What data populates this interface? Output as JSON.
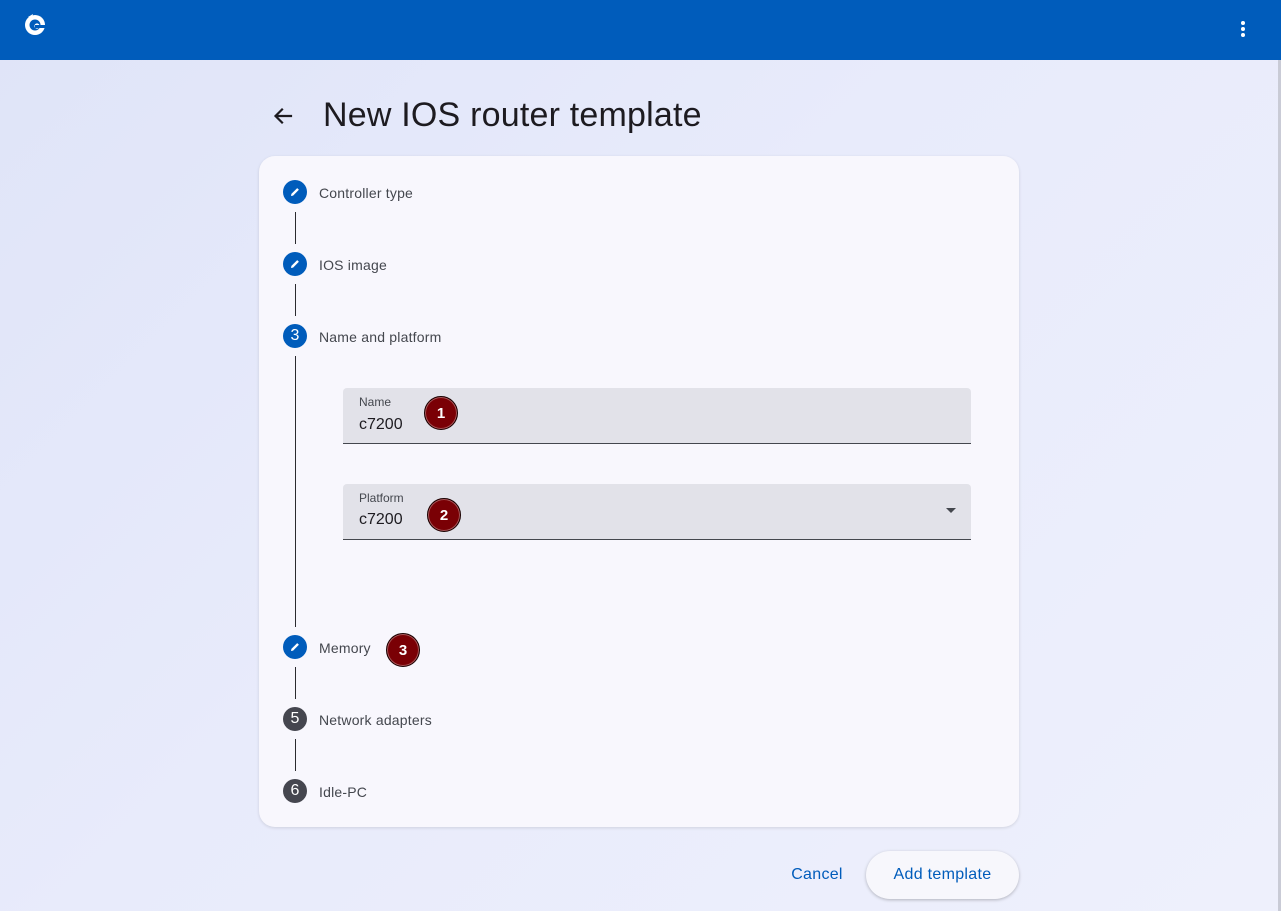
{
  "page": {
    "title": "New IOS router template"
  },
  "steps": [
    {
      "number": "",
      "label": "Controller type",
      "state": "edit",
      "icon": "pencil-icon"
    },
    {
      "number": "",
      "label": "IOS image",
      "state": "edit",
      "icon": "pencil-icon"
    },
    {
      "number": "3",
      "label": "Name and platform",
      "state": "active"
    },
    {
      "number": "",
      "label": "Memory",
      "state": "edit",
      "icon": "pencil-icon"
    },
    {
      "number": "5",
      "label": "Network adapters",
      "state": "pending"
    },
    {
      "number": "6",
      "label": "Idle-PC",
      "state": "pending"
    }
  ],
  "form": {
    "name_label": "Name",
    "name_value": "c7200",
    "platform_label": "Platform",
    "platform_value": "c7200"
  },
  "markers": [
    "1",
    "2",
    "3"
  ],
  "actions": {
    "cancel_label": "Cancel",
    "add_label": "Add template"
  },
  "colors": {
    "topbar": "#005cbb",
    "accent": "#005cbb",
    "marker": "#7a0005"
  }
}
